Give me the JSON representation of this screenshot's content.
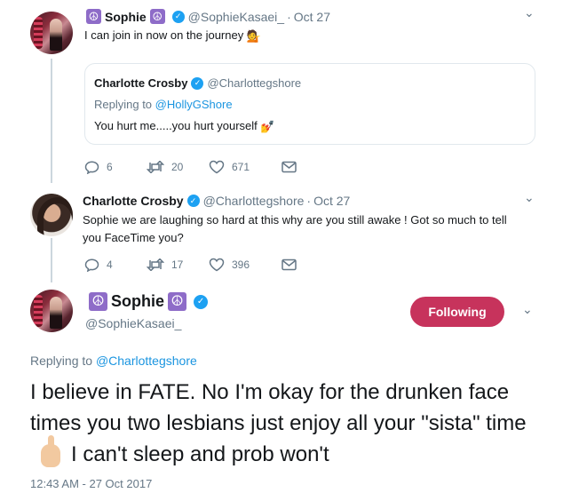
{
  "tweet1": {
    "name": "Sophie",
    "handle": "@SophieKasaei_",
    "separator": "·",
    "date": "Oct 27",
    "text": "I can join in now on the journey",
    "emoji": "💁"
  },
  "quote": {
    "name": "Charlotte Crosby",
    "handle": "@Charlottegshore",
    "reply_prefix": "Replying to",
    "reply_to": "@HollyGShore",
    "text": "You hurt me.....you hurt yourself",
    "emoji": "💅"
  },
  "tweet1_actions": {
    "replies": "6",
    "retweets": "20",
    "likes": "671"
  },
  "tweet2": {
    "name": "Charlotte Crosby",
    "handle": "@Charlottegshore",
    "separator": "·",
    "date": "Oct 27",
    "text": "Sophie we are laughing so hard at this why are you still awake ! Got so much to tell you FaceTime you?"
  },
  "tweet2_actions": {
    "replies": "4",
    "retweets": "17",
    "likes": "396"
  },
  "main_tweet": {
    "name": "Sophie",
    "handle": "@SophieKasaei_",
    "follow_label": "Following",
    "reply_prefix": "Replying to",
    "reply_to": "@Charlottegshore",
    "text_part1": "I believe in FATE. No I'm okay for the drunken face times you two lesbians just enjoy all your \"sista\" time",
    "text_part2": "I can't sleep and prob won't",
    "timestamp": "12:43 AM - 27 Oct 2017"
  },
  "icons": {
    "peace": "☮",
    "verified": "✓",
    "caret": "⌄"
  },
  "colors": {
    "follow_button": "#c7335c",
    "verified": "#1da1f2",
    "link": "#1b95e0",
    "muted": "#657786",
    "peace_badge": "#8e6cc8"
  }
}
